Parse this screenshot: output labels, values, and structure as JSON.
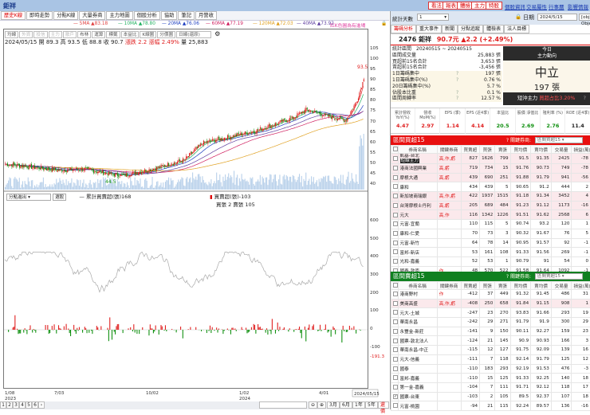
{
  "window": {
    "title": "鉅祥"
  },
  "top_buttons": [
    "看法",
    "報表",
    "體檢",
    "主力",
    "特股"
  ],
  "top_links": [
    "個股資訊",
    "交易屬性",
    "行事曆",
    "影響情報"
  ],
  "left_tabs": [
    "歷史K線",
    "即時走勢",
    "分點K線",
    "大量券商",
    "主力地圖",
    "個股分析",
    "協助",
    "筆記",
    "月營收"
  ],
  "ma": [
    {
      "label": "5MA",
      "value": "83.18",
      "color": "#e04040"
    },
    {
      "label": "10MA",
      "value": "78.80",
      "color": "#20b060"
    },
    {
      "label": "20MA",
      "value": "76.06",
      "color": "#2040c0"
    },
    {
      "label": "60MA",
      "value": "77.19",
      "color": "#d02060"
    },
    {
      "label": "120MA",
      "value": "72.03",
      "color": "#e0a020"
    },
    {
      "label": "40MA",
      "value": "73.92",
      "color": "#6040a0"
    }
  ],
  "ma_note": "紅K色圓為有進場",
  "toolbar": {
    "buttons": [
      "均線",
      "外資",
      "投信",
      "主力",
      "散戶",
      "布林",
      "運算",
      "標籤",
      "本益比",
      "K線圖",
      "分價圖"
    ],
    "period": "日線(還原)"
  },
  "ohlc": {
    "date": "2024/05/15",
    "open_label": "開",
    "open": "89.3",
    "high_label": "高",
    "high": "93.5",
    "low_label": "低",
    "low": "88.8",
    "close_label": "收",
    "close": "90.7",
    "chg_label": "漲跌",
    "chg": "2.2",
    "pct_label": "漲幅",
    "pct": "2.49%",
    "vol_label": "量",
    "vol": "25,883"
  },
  "price_axis": [
    "105",
    "100",
    "95",
    "90",
    "85",
    "80",
    "75",
    "70",
    "65",
    "60",
    "55",
    "50",
    "45",
    "40"
  ],
  "price_high_marker": "93.5",
  "price_low_marker": "44.5",
  "lower": {
    "select": "分點進出",
    "button": "選股",
    "cum_label": "累計買賣超(張)168",
    "net_label": "買賣超(張)-103",
    "bs_label": "買張 2 賣張 105",
    "axis": [
      "600",
      "500",
      "400",
      "300",
      "200",
      "100",
      "0",
      "-100"
    ],
    "last_value": "-191.3"
  },
  "x_axis": [
    {
      "d": "1/08",
      "y": "2023"
    },
    {
      "d": "7/03",
      "y": ""
    },
    {
      "d": "10/02",
      "y": ""
    },
    {
      "d": "1/02",
      "y": "2024"
    },
    {
      "d": "4/01",
      "y": ""
    }
  ],
  "x_current": "2024/05/15",
  "bottom": {
    "pages": [
      "1",
      "2",
      "3",
      "4",
      "5",
      "6"
    ],
    "ranges": [
      "3月",
      "6月",
      "1年",
      "5年"
    ],
    "end": "還價"
  },
  "right": {
    "stat_days_label": "統計天數",
    "stat_days": "1",
    "date_label": "日期",
    "date": "2024/5/15",
    "today": {
      "l1": "今日",
      "l2": "主力動向",
      "stance": "中立",
      "lots": "197 張",
      "short_label": "短沖主力",
      "short_value": "買超占比3.20%",
      "q": "?"
    },
    "tabs": [
      "籌碼分析",
      "重大事件",
      "新聞",
      "分點追蹤",
      "體檢表",
      "法人目標"
    ],
    "stock": {
      "code": "2476",
      "name": "鉅祥",
      "price": "90.7元",
      "change": "▲2.2 (+2.49%)"
    },
    "stats": [
      {
        "k": "統計區間",
        "q": "",
        "v": "20240515 ~ 20240515"
      },
      {
        "k": "區間成交量",
        "q": "",
        "v": "25,883 張"
      },
      {
        "k": "買超前15名合計",
        "q": "",
        "v": "3,653 張"
      },
      {
        "k": "賣超前15名合計",
        "q": "",
        "v": "-3,456 張"
      },
      {
        "k": "1日籌碼集中",
        "q": "?",
        "v": "197 張"
      },
      {
        "k": "1日籌碼集中(%)",
        "q": "?",
        "v": "0.76 %"
      },
      {
        "k": "20日籌碼集中(%)",
        "q": "",
        "v": "5.7 %"
      },
      {
        "k": "佔股本比重",
        "q": "?",
        "v": "0.1 %"
      },
      {
        "k": "區間周轉率",
        "q": "?",
        "v": "12.57 %"
      }
    ],
    "fin": [
      {
        "h": "累計營收 YoY(%)",
        "v": "4.47",
        "c": "#e02020"
      },
      {
        "h": "營收 MoM(%)",
        "v": "2.97",
        "c": "#e02020"
      },
      {
        "h": "EPS (季)",
        "v": "1.14",
        "c": "#e02020"
      },
      {
        "h": "EPS (近4季)",
        "v": "4.14",
        "c": "#e02020"
      },
      {
        "h": "本益比",
        "v": "20.5",
        "c": "#109010"
      },
      {
        "h": "股價 淨值比",
        "v": "2.69",
        "c": "#109010"
      },
      {
        "h": "殖利率 (%)",
        "v": "2.76",
        "c": "#109010"
      },
      {
        "h": "ROE (近4季)",
        "v": "11.4",
        "c": "#222"
      }
    ],
    "columns": [
      "券商名稱",
      "關鍵券商",
      "買賣超",
      "買張",
      "賣張",
      "買均價",
      "賣均價",
      "交易量",
      "損益(萬)"
    ],
    "buy": {
      "title": "區間買超15",
      "key_label": "? 關鍵券商:",
      "key_select": "區間買超15",
      "color": "#e81010",
      "rows": [
        {
          "name": "凱基-台北",
          "tag": "短線主力",
          "key": "高,作,虧",
          "v": [
            "827",
            "1626",
            "799",
            "91.5",
            "91.35",
            "2425",
            "-78"
          ]
        },
        {
          "name": "港商法國興業",
          "key": "高,虧",
          "v": [
            "719",
            "734",
            "15",
            "91.76",
            "90.73",
            "749",
            "-78"
          ]
        },
        {
          "name": "摩根大通",
          "key": "高,虧",
          "v": [
            "439",
            "690",
            "251",
            "91.88",
            "91.79",
            "941",
            "-56"
          ]
        },
        {
          "name": "康和",
          "key": "",
          "v": [
            "434",
            "439",
            "5",
            "90.65",
            "91.2",
            "444",
            "2"
          ]
        },
        {
          "name": "新加坡商瑞銀",
          "key": "高,作,虧",
          "v": [
            "422",
            "1937",
            "1515",
            "91.18",
            "91.34",
            "3452",
            "4"
          ]
        },
        {
          "name": "台灣摩根士丹利",
          "key": "高,虧",
          "v": [
            "205",
            "689",
            "484",
            "91.23",
            "91.12",
            "1173",
            "-16"
          ]
        },
        {
          "name": "元大",
          "key": "高,作",
          "v": [
            "116",
            "1342",
            "1226",
            "91.51",
            "91.62",
            "2568",
            "6"
          ]
        },
        {
          "name": "元富-宜蘭",
          "key": "",
          "v": [
            "110",
            "115",
            "5",
            "90.74",
            "93.2",
            "120",
            "1"
          ]
        },
        {
          "name": "康和-仁愛",
          "key": "",
          "v": [
            "70",
            "73",
            "3",
            "90.32",
            "91.67",
            "76",
            "5"
          ]
        },
        {
          "name": "元富-新竹",
          "key": "",
          "v": [
            "64",
            "78",
            "14",
            "90.95",
            "91.57",
            "92",
            "-1"
          ]
        },
        {
          "name": "富邦-新店",
          "key": "",
          "v": [
            "53",
            "161",
            "108",
            "91.33",
            "91.56",
            "269",
            "-1"
          ]
        },
        {
          "name": "光和-嘉義",
          "key": "",
          "v": [
            "52",
            "53",
            "1",
            "90.79",
            "91",
            "54",
            "0"
          ]
        },
        {
          "name": "國泰-敦南",
          "key": "作",
          "v": [
            "48",
            "570",
            "522",
            "91.58",
            "91.64",
            "1092",
            "-1"
          ]
        }
      ]
    },
    "sell": {
      "title": "區間賣超15",
      "key_label": "? 關鍵券商:",
      "key_select": "區間賣超15",
      "color": "#108020",
      "rows": [
        {
          "name": "港商野村",
          "key": "作",
          "v": [
            "-412",
            "37",
            "449",
            "91.32",
            "91.45",
            "486",
            "31"
          ]
        },
        {
          "name": "美商高盛",
          "key": "高,作,虧",
          "v": [
            "-408",
            "250",
            "658",
            "91.84",
            "91.15",
            "908",
            "1"
          ]
        },
        {
          "name": "元大-土城",
          "key": "",
          "v": [
            "-247",
            "23",
            "270",
            "93.83",
            "91.66",
            "293",
            "19"
          ]
        },
        {
          "name": "華南永昌",
          "key": "",
          "v": [
            "-242",
            "29",
            "271",
            "91.79",
            "91.9",
            "300",
            "29"
          ]
        },
        {
          "name": "永豐金-新莊",
          "key": "",
          "v": [
            "-141",
            "9",
            "150",
            "90.11",
            "92.27",
            "159",
            "23"
          ]
        },
        {
          "name": "國票-敦北法人",
          "key": "",
          "v": [
            "-124",
            "21",
            "145",
            "90.9",
            "90.93",
            "166",
            "3"
          ]
        },
        {
          "name": "華南永昌-中正",
          "key": "",
          "v": [
            "-115",
            "12",
            "127",
            "91.75",
            "92.09",
            "139",
            "16"
          ]
        },
        {
          "name": "元大-信義",
          "key": "",
          "v": [
            "-111",
            "7",
            "118",
            "92.14",
            "91.79",
            "125",
            "12"
          ]
        },
        {
          "name": "國泰",
          "key": "",
          "v": [
            "-110",
            "183",
            "293",
            "92.19",
            "91.53",
            "476",
            "-3"
          ]
        },
        {
          "name": "富邦-嘉義",
          "key": "",
          "v": [
            "-110",
            "15",
            "125",
            "91.33",
            "92.25",
            "140",
            "18"
          ]
        },
        {
          "name": "第一金-嘉義",
          "key": "",
          "v": [
            "-104",
            "7",
            "111",
            "91.71",
            "92.12",
            "118",
            "17"
          ]
        },
        {
          "name": "國票-台東",
          "key": "",
          "checked": true,
          "v": [
            "-103",
            "2",
            "105",
            "89.5",
            "92.37",
            "107",
            "18"
          ]
        },
        {
          "name": "元富-桃園",
          "key": "",
          "v": [
            "-94",
            "21",
            "115",
            "92.24",
            "89.57",
            "136",
            "-16"
          ]
        }
      ]
    }
  }
}
